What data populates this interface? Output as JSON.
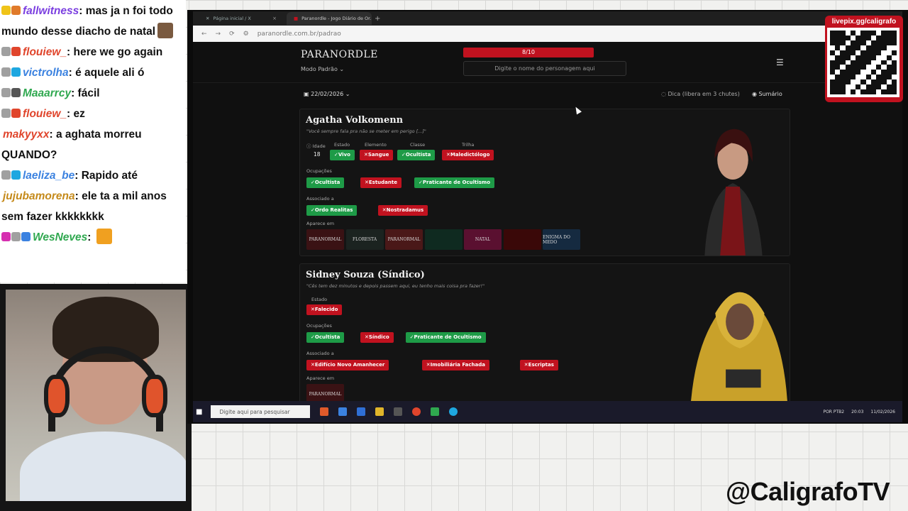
{
  "chat": [
    {
      "user": "fallwitness",
      "user_color": "#7b3fe0",
      "message": "mas ja n foi todo mundo desse diacho de natal",
      "badges": [
        "#f0c419",
        "#e07a2a"
      ],
      "emote": true
    },
    {
      "user": "flouiew_",
      "user_color": "#e0452c",
      "message": "here we go again",
      "badges": [
        "#a0a0a0",
        "#e0452c"
      ]
    },
    {
      "user": "victrolha",
      "user_color": "#3b82e0",
      "message": "é aquele ali ó",
      "badges": [
        "#a0a0a0",
        "#1ea7e0"
      ]
    },
    {
      "user": "Maaarrcy",
      "user_color": "#2fa84f",
      "message": "fácil",
      "badges": [
        "#a0a0a0",
        "#555555"
      ]
    },
    {
      "user": "flouiew_",
      "user_color": "#e0452c",
      "message": "ez",
      "badges": [
        "#a0a0a0",
        "#e0452c"
      ]
    },
    {
      "user": "makyyxx",
      "user_color": "#e0452c",
      "message": "a aghata morreu QUANDO?",
      "badges": []
    },
    {
      "user": "laeliza_be",
      "user_color": "#3b82e0",
      "message": "Rapido até",
      "badges": [
        "#a0a0a0",
        "#1ea7e0"
      ]
    },
    {
      "user": "jujubamorena",
      "user_color": "#c58a1a",
      "message": "ele ta a mil anos sem fazer kkkkkkkk",
      "badges": []
    },
    {
      "user": "WesNeves",
      "user_color": "#2fa84f",
      "message": "",
      "badges": [
        "#d62fb0",
        "#a0a0a0",
        "#3b82e0"
      ],
      "emote": true
    }
  ],
  "browser": {
    "tabs": [
      "Página inicial / X",
      "Paranordle - Jogo Diário de Or..."
    ],
    "url": "paranordle.com.br/padrao",
    "nav_back": "←",
    "nav_forward": "→",
    "nav_reload": "⟳",
    "new_tab": "+"
  },
  "site": {
    "logo": "PARANORDLE",
    "mode": "Modo Padrão ⌄",
    "progress_label": "8/10",
    "progress_fraction": 0.8,
    "guess_placeholder": "Digite o nome do personagem aqui",
    "menu_icon": "☰",
    "date": "▣ 22/02/2026 ⌄",
    "hint": "◌ Dica (libera em 3 chutes)",
    "summary": "◉ Sumário"
  },
  "cards": [
    {
      "name": "Agatha Volkomenn",
      "quote": "\"Você sempre fala pra não se meter em perigo [...]\"",
      "labels": {
        "idade": "ⓘ Idade",
        "estado": "Estado",
        "elemento": "Elemento",
        "classe": "Classe",
        "trilha": "Trilha",
        "ocupacoes": "Ocupações",
        "associado": "Associado a",
        "aparece": "Aparece em"
      },
      "idade": "18",
      "estado": {
        "text": "✓Vivo",
        "ok": true
      },
      "elemento": {
        "text": "✕Sangue",
        "ok": false
      },
      "classe": {
        "text": "✓Ocultista",
        "ok": true
      },
      "trilha": {
        "text": "✕Maledictólogo",
        "ok": false
      },
      "ocupacoes": [
        {
          "text": "✓Ocultista",
          "ok": true
        },
        {
          "text": "✕Estudante",
          "ok": false
        },
        {
          "text": "✓Praticante de Ocultismo",
          "ok": true
        }
      ],
      "associado": [
        {
          "text": "✓Ordo Realitas",
          "ok": true
        },
        {
          "text": "✕Nostradamus",
          "ok": false
        }
      ],
      "aparece": [
        {
          "title": "PARANORMAL",
          "color": "#3a1214"
        },
        {
          "title": "FLORESTA",
          "color": "#1b2320"
        },
        {
          "title": "PARANORMAL",
          "color": "#4a1818"
        },
        {
          "title": "",
          "color": "#0f2a20"
        },
        {
          "title": "NATAL",
          "color": "#5a1030"
        },
        {
          "title": "",
          "color": "#3a0808"
        },
        {
          "title": "ENIGMA DO MEDO",
          "color": "#152a40"
        }
      ]
    },
    {
      "name": "Sidney Souza (Síndico)",
      "quote": "\"Cês tem dez minutos e depois passem aqui, eu tenho mais coisa pra fazer!\"",
      "labels": {
        "estado": "Estado",
        "ocupacoes": "Ocupações",
        "associado": "Associado a",
        "aparece": "Aparece em"
      },
      "estado": {
        "text": "✕Falecido",
        "ok": false
      },
      "ocupacoes": [
        {
          "text": "✓Ocultista",
          "ok": true
        },
        {
          "text": "✕Síndico",
          "ok": false
        },
        {
          "text": "✓Praticante de Ocultismo",
          "ok": true
        }
      ],
      "associado": [
        {
          "text": "✕Edifício Novo Amanhecer",
          "ok": false
        },
        {
          "text": "✕Imobiliária Fachada",
          "ok": false
        },
        {
          "text": "✕Escriptas",
          "ok": false
        }
      ],
      "aparece": [
        {
          "title": "PARANORMAL",
          "color": "#3a1214"
        }
      ]
    }
  ],
  "taskbar": {
    "search_placeholder": "Digite aqui para pesquisar",
    "lang": "POR PTB2",
    "time": "20:03",
    "date": "11/02/2026"
  },
  "overlay": {
    "qr_label": "livepix.gg/caligrafo",
    "handle": "@CaligrafoTV"
  }
}
